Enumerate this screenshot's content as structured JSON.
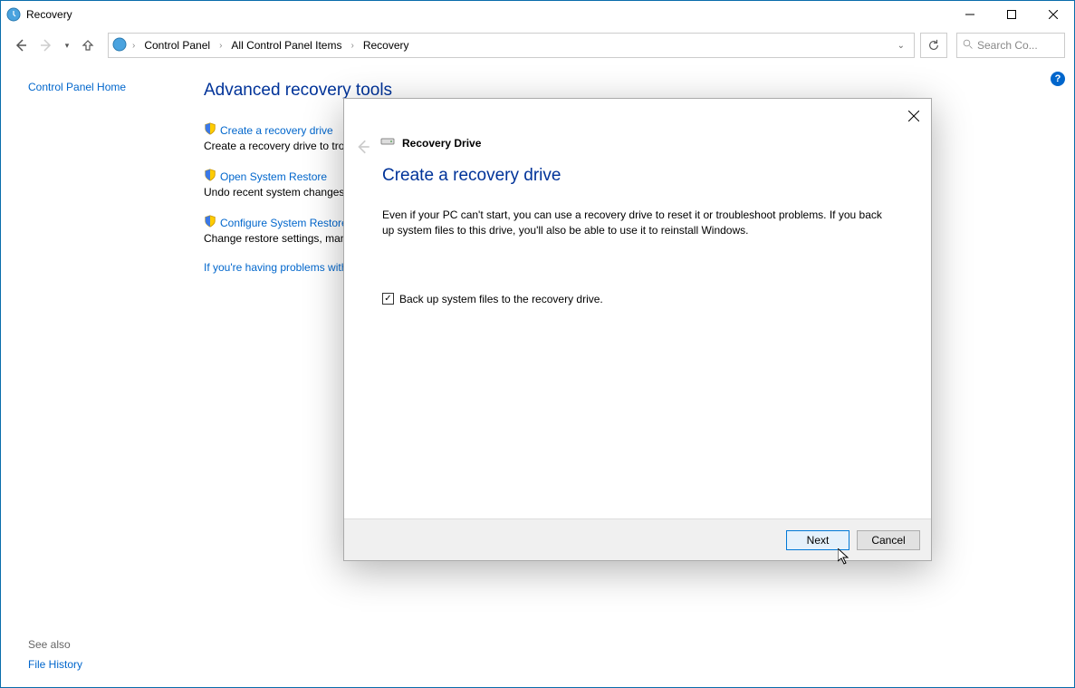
{
  "window": {
    "title": "Recovery"
  },
  "breadcrumb": {
    "items": [
      "Control Panel",
      "All Control Panel Items",
      "Recovery"
    ]
  },
  "search": {
    "placeholder": "Search Co..."
  },
  "sidebar": {
    "home": "Control Panel Home"
  },
  "main": {
    "heading": "Advanced recovery tools",
    "tools": [
      {
        "link": "Create a recovery drive",
        "desc": "Create a recovery drive to troubleshoot problems when your PC can't start."
      },
      {
        "link": "Open System Restore",
        "desc": "Undo recent system changes, but leave files such as documents, pictures, and music unchanged."
      },
      {
        "link": "Configure System Restore",
        "desc": "Change restore settings, manage disk space, and create or delete restore points."
      }
    ],
    "trouble": "If you're having problems with your PC, you can refresh it in PC settings."
  },
  "seealso": {
    "header": "See also",
    "link": "File History"
  },
  "dialog": {
    "header_title": "Recovery Drive",
    "title": "Create a recovery drive",
    "body": "Even if your PC can't start, you can use a recovery drive to reset it or troubleshoot problems. If you back up system files to this drive, you'll also be able to use it to reinstall Windows.",
    "checkbox": "Back up system files to the recovery drive.",
    "next": "Next",
    "cancel": "Cancel"
  }
}
